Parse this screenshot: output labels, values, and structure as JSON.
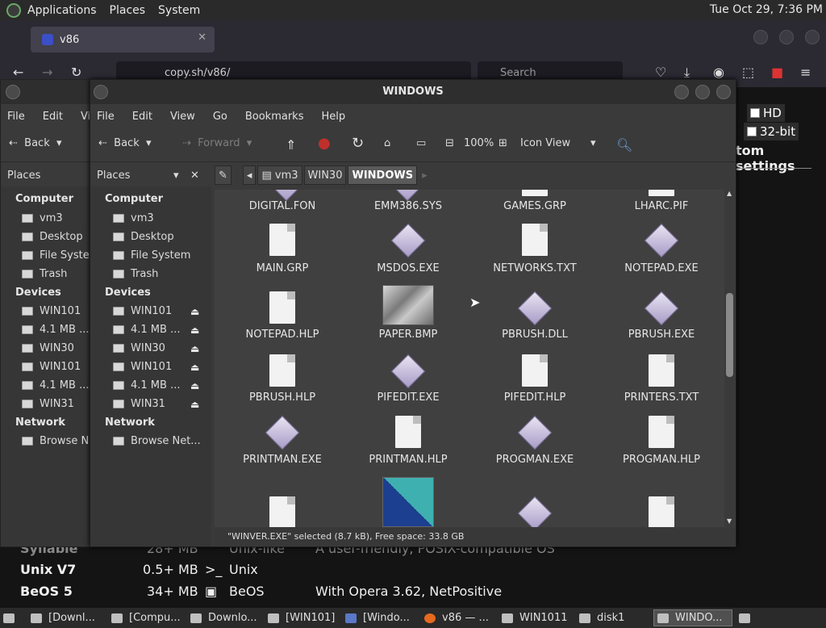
{
  "topbar": {
    "apps": "Applications",
    "places": "Places",
    "system": "System",
    "clock": "Tue Oct 29,  7:36 PM"
  },
  "browser": {
    "tab_title": "v86",
    "url": "copy.sh/v86/",
    "search_placeholder": "Search"
  },
  "page": {
    "hd_label": "HD",
    "bit_label": "32-bit",
    "custom_settings": "tom settings",
    "rows": [
      {
        "name": "Syllable",
        "size": "28+ MB",
        "type": "Unix-like",
        "desc": "A user-friendly, POSIX-compatible OS"
      },
      {
        "name": "Unix V7",
        "size": "0.5+ MB",
        "type": "Unix",
        "desc": ""
      },
      {
        "name": "BeOS 5",
        "size": "34+ MB",
        "type": "BeOS",
        "desc": "With Opera 3.62, NetPositive"
      }
    ]
  },
  "backwin": {
    "menu": [
      "File",
      "Edit",
      "Vi"
    ],
    "back": "Back",
    "places": "Places",
    "computer_h": "Computer",
    "computer_items": [
      "vm3",
      "Desktop",
      "File Syster",
      "Trash"
    ],
    "devices_h": "Devices",
    "devices": [
      "WIN101",
      "4.1 MB ...",
      "WIN30",
      "WIN101",
      "4.1 MB ...",
      "WIN31"
    ],
    "network_h": "Network",
    "network_item": "Browse Ne"
  },
  "frontwin": {
    "title": "WINDOWS",
    "menu": [
      "File",
      "Edit",
      "View",
      "Go",
      "Bookmarks",
      "Help"
    ],
    "back": "Back",
    "forward": "Forward",
    "zoom": "100%",
    "view_mode": "Icon View",
    "places": "Places",
    "computer_h": "Computer",
    "computer_items": [
      "vm3",
      "Desktop",
      "File System",
      "Trash"
    ],
    "devices_h": "Devices",
    "devices": [
      "WIN101",
      "4.1 MB ...",
      "WIN30",
      "WIN101",
      "4.1 MB ...",
      "WIN31"
    ],
    "network_h": "Network",
    "network_item": "Browse Net...",
    "crumbs": [
      "vm3",
      "WIN30",
      "WINDOWS"
    ],
    "files": [
      [
        "DIGITAL.FON",
        "EMM386.SYS",
        "GAMES.GRP",
        "LHARC.PIF"
      ],
      [
        "MAIN.GRP",
        "MSDOS.EXE",
        "NETWORKS.TXT",
        "NOTEPAD.EXE"
      ],
      [
        "NOTEPAD.HLP",
        "PAPER.BMP",
        "PBRUSH.DLL",
        "PBRUSH.EXE"
      ],
      [
        "PBRUSH.HLP",
        "PIFEDIT.EXE",
        "PIFEDIT.HLP",
        "PRINTERS.TXT"
      ],
      [
        "PRINTMAN.EXE",
        "PRINTMAN.HLP",
        "PROGMAN.EXE",
        "PROGMAN.HLP"
      ]
    ],
    "status": "\"WINVER.EXE\" selected (8.7 kB), Free space: 33.8 GB"
  },
  "taskbar": [
    "[Downl...",
    "[Compu...",
    "Downlo...",
    "[WIN101]",
    "[Windo...",
    "v86 — ...",
    "WIN1011",
    "disk1",
    "WINDO..."
  ]
}
